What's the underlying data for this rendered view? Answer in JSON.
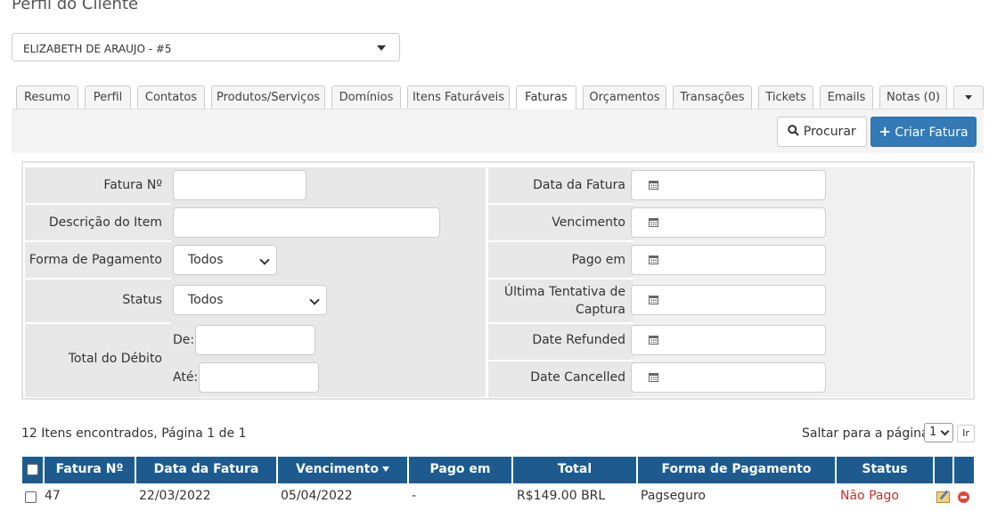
{
  "page": {
    "title": "Perfil do Cliente"
  },
  "client_selector": {
    "value": "ELIZABETH DE ARAUJO - #5"
  },
  "tabs": [
    {
      "label": "Resumo"
    },
    {
      "label": "Perfil"
    },
    {
      "label": "Contatos"
    },
    {
      "label": "Produtos/Serviços"
    },
    {
      "label": "Domínios"
    },
    {
      "label": "Itens Faturáveis"
    },
    {
      "label": "Faturas"
    },
    {
      "label": "Orçamentos"
    },
    {
      "label": "Transações"
    },
    {
      "label": "Tickets"
    },
    {
      "label": "Emails"
    },
    {
      "label": "Notas (0)"
    }
  ],
  "active_tab": "Faturas",
  "toolbar": {
    "search_label": "Procurar",
    "create_label": "Criar Fatura"
  },
  "filters": {
    "invoice_number": {
      "label": "Fatura Nº",
      "value": ""
    },
    "item_description": {
      "label": "Descrição do Item",
      "value": ""
    },
    "payment_method": {
      "label": "Forma de Pagamento",
      "value": "Todos"
    },
    "status": {
      "label": "Status",
      "value": "Todos"
    },
    "total_due": {
      "label": "Total do Débito",
      "from_label": "De:",
      "to_label": "Até:"
    },
    "invoice_date": {
      "label": "Data da Fatura"
    },
    "due_date": {
      "label": "Vencimento"
    },
    "paid_on": {
      "label": "Pago em"
    },
    "last_capture": {
      "label_line1": "Última Tentativa de",
      "label_line2": "Captura"
    },
    "date_refunded": {
      "label": "Date Refunded"
    },
    "date_cancelled": {
      "label": "Date Cancelled"
    }
  },
  "pagination": {
    "results_text": "12 Itens encontrados, Página 1 de 1",
    "jump_label": "Saltar para a página:",
    "jump_value": "1",
    "go_label": "Ir"
  },
  "table": {
    "headers": [
      "Fatura Nº",
      "Data da Fatura",
      "Vencimento",
      "Pago em",
      "Total",
      "Forma de Pagamento",
      "Status"
    ],
    "rows": [
      {
        "number": "47",
        "date": "22/03/2022",
        "due": "05/04/2022",
        "paid": "-",
        "total": "R$149.00 BRL",
        "method": "Pagseguro",
        "status": "Não Pago"
      }
    ]
  },
  "colors": {
    "header_bg": "#1d5b8f",
    "primary_button": "#337ab7",
    "status_unpaid": "#c9302c"
  }
}
